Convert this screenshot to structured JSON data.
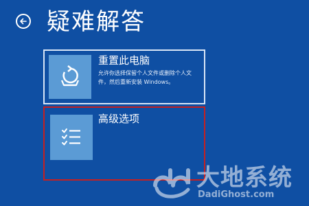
{
  "header": {
    "back_icon": "back-arrow-icon",
    "title": "疑难解答"
  },
  "options": {
    "reset": {
      "icon": "reset-pc-icon",
      "title": "重置此电脑",
      "description": "允许你选择保留个人文件或删除个人文件，然后重新安装 Windows。"
    },
    "advanced": {
      "icon": "checklist-icon",
      "title": "高级选项"
    }
  },
  "watermark": {
    "name": "大地系统",
    "url": "DadiGhost.com"
  },
  "colors": {
    "background": "#0f4fa3",
    "tile": "#5b9bd5",
    "highlight_border": "#c62020"
  }
}
